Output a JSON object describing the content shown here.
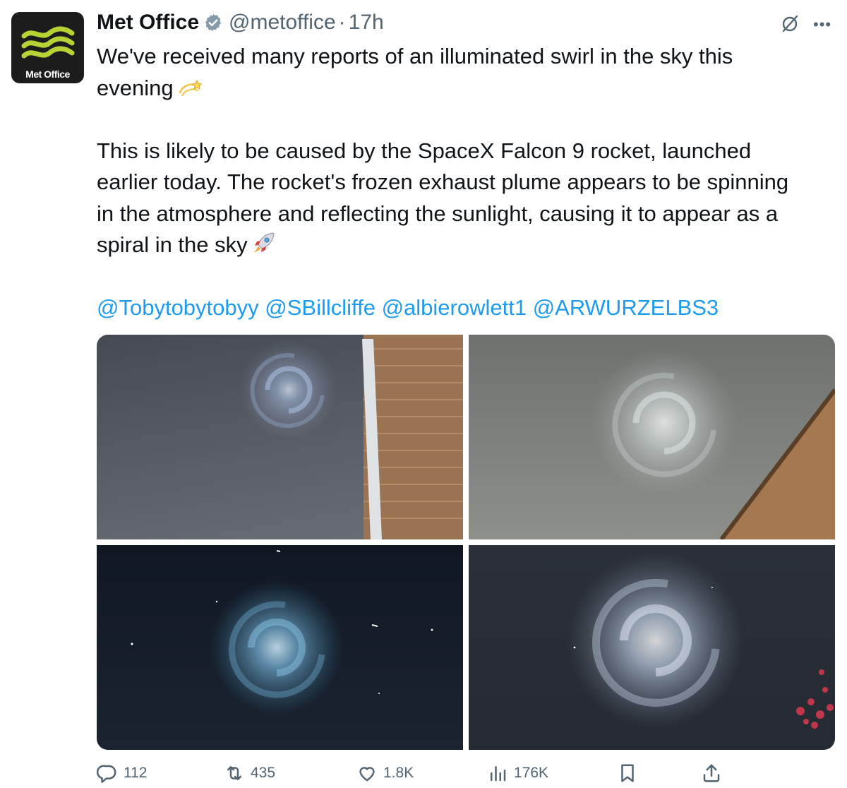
{
  "account": {
    "display_name": "Met Office",
    "handle": "@metoffice",
    "separator": "·",
    "time": "17h",
    "avatar_text": "Met Office",
    "verified": true
  },
  "tweet": {
    "paragraph1": "We've received many reports of an illuminated swirl in the sky this",
    "paragraph1_line2": "evening",
    "paragraph1_emoji": "dizzy-emoji",
    "paragraph2_line1": "This is likely to be caused by the SpaceX Falcon 9 rocket, launched",
    "paragraph2_line2": "earlier today. The rocket's frozen exhaust plume appears to be spinning",
    "paragraph2_line3": "in the atmosphere and reflecting the sunlight, causing it to appear as a",
    "paragraph2_line4": "spiral in the sky",
    "paragraph2_emoji": "rocket-emoji",
    "mentions": [
      "@Tobytobytobyy",
      "@SBillcliffe",
      "@albierowlett1",
      "@ARWURZELBS3"
    ]
  },
  "media": {
    "photos": [
      {
        "name": "photo-1",
        "description_icon": "spiral-sky-photo"
      },
      {
        "name": "photo-2",
        "description_icon": "spiral-sky-photo"
      },
      {
        "name": "photo-3",
        "description_icon": "spiral-sky-photo"
      },
      {
        "name": "photo-4",
        "description_icon": "spiral-sky-photo"
      }
    ]
  },
  "actions": {
    "replies": "112",
    "retweets": "435",
    "likes": "1.8K",
    "views": "176K"
  },
  "colors": {
    "text": "#0f1419",
    "secondary": "#536471",
    "link": "#1d9bf0",
    "verified": "#829aab",
    "logo_green": "#b5d334"
  }
}
